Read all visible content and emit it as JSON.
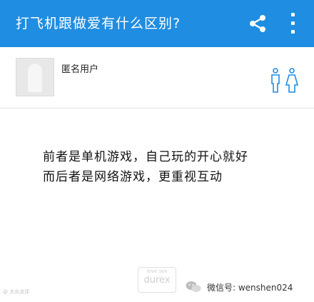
{
  "app_bar": {
    "title": "打飞机跟做爱有什么区别?",
    "share_icon": "share-icon",
    "more_icon": "more-vertical-icon",
    "color": "#1f8de1"
  },
  "author": {
    "name": "匿名用户",
    "avatar_icon": "anonymous-avatar-icon",
    "gender_icon": "male-female-icon"
  },
  "answer": {
    "lines": [
      "前者是单机游戏，自己玩的开心就好",
      "而后者是网络游戏，更重视互动"
    ]
  },
  "footer": {
    "brand_mark_top": "love sex",
    "brand_mark": "durex",
    "weibo_watermark": "@ 大众点评",
    "wechat_label": "微信号: wenshen024"
  }
}
